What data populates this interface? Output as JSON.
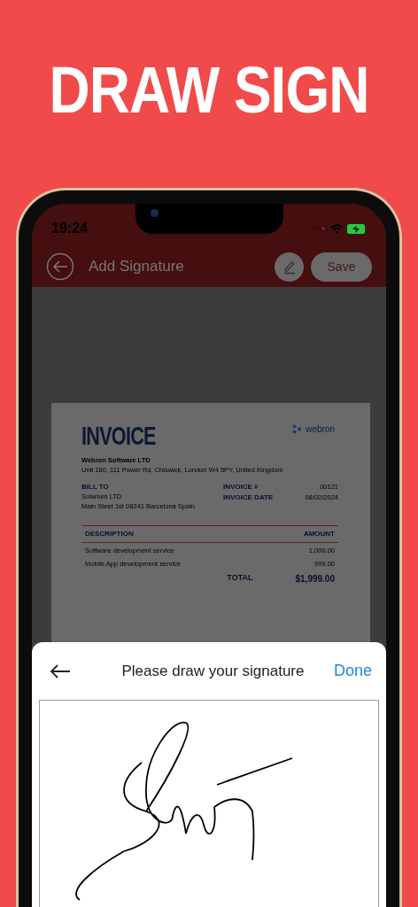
{
  "headline": "DRAW SIGN",
  "status_bar": {
    "time": "19:24"
  },
  "app_bar": {
    "title": "Add Signature",
    "save_button": "Save"
  },
  "invoice": {
    "title": "INVOICE",
    "logo_text": "webron",
    "company": "Webron Software LTD",
    "address": "Unit 160, 111 Power Rd, Chiswick, London W4 5PY, United Kingdom",
    "bill_to_label": "BILL TO",
    "client": "Solarium LTD",
    "client_address": "Main Steet 1st 08241 Barcelona Spain",
    "meta": [
      {
        "label": "INVOICE #",
        "value": "00121"
      },
      {
        "label": "INVOICE DATE",
        "value": "08/02/2024"
      }
    ],
    "columns": [
      "DESCRIPTION",
      "AMOUNT"
    ],
    "items": [
      {
        "description": "Software development service",
        "amount": "1,000.00"
      },
      {
        "description": "Mobile App development service",
        "amount": "999.00"
      }
    ],
    "total_label": "TOTAL",
    "total": "$1,999.00"
  },
  "sheet": {
    "title": "Please draw your signature",
    "done_button": "Done"
  }
}
